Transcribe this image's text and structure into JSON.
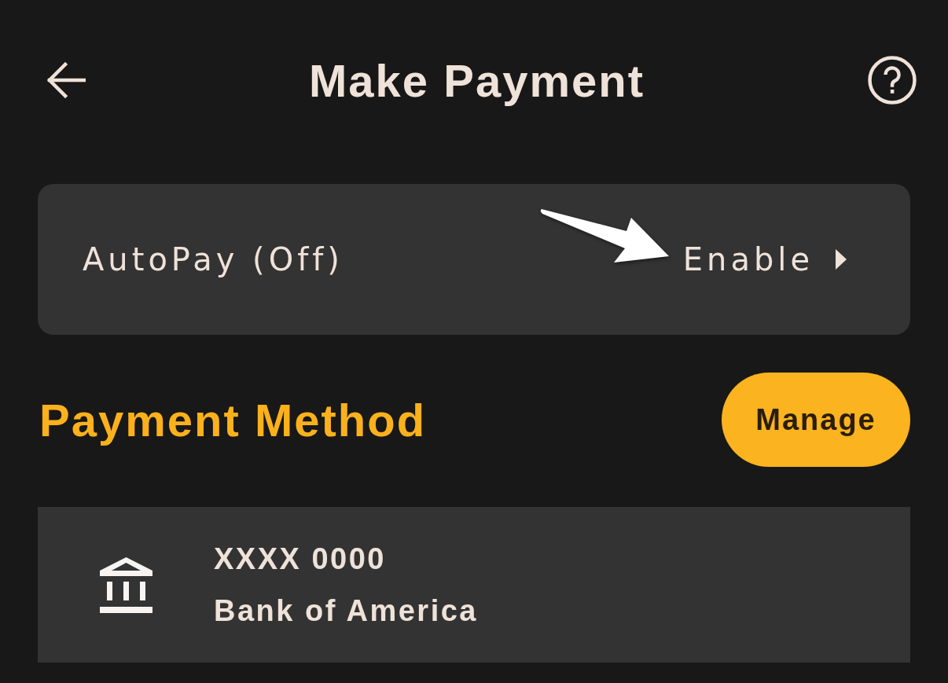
{
  "header": {
    "title": "Make Payment"
  },
  "autopay": {
    "label": "AutoPay (Off)",
    "action": "Enable"
  },
  "payment_method": {
    "heading": "Payment Method",
    "manage_button": "Manage",
    "accounts": [
      {
        "number": "XXXX 0000",
        "name": "Bank of America"
      }
    ]
  }
}
